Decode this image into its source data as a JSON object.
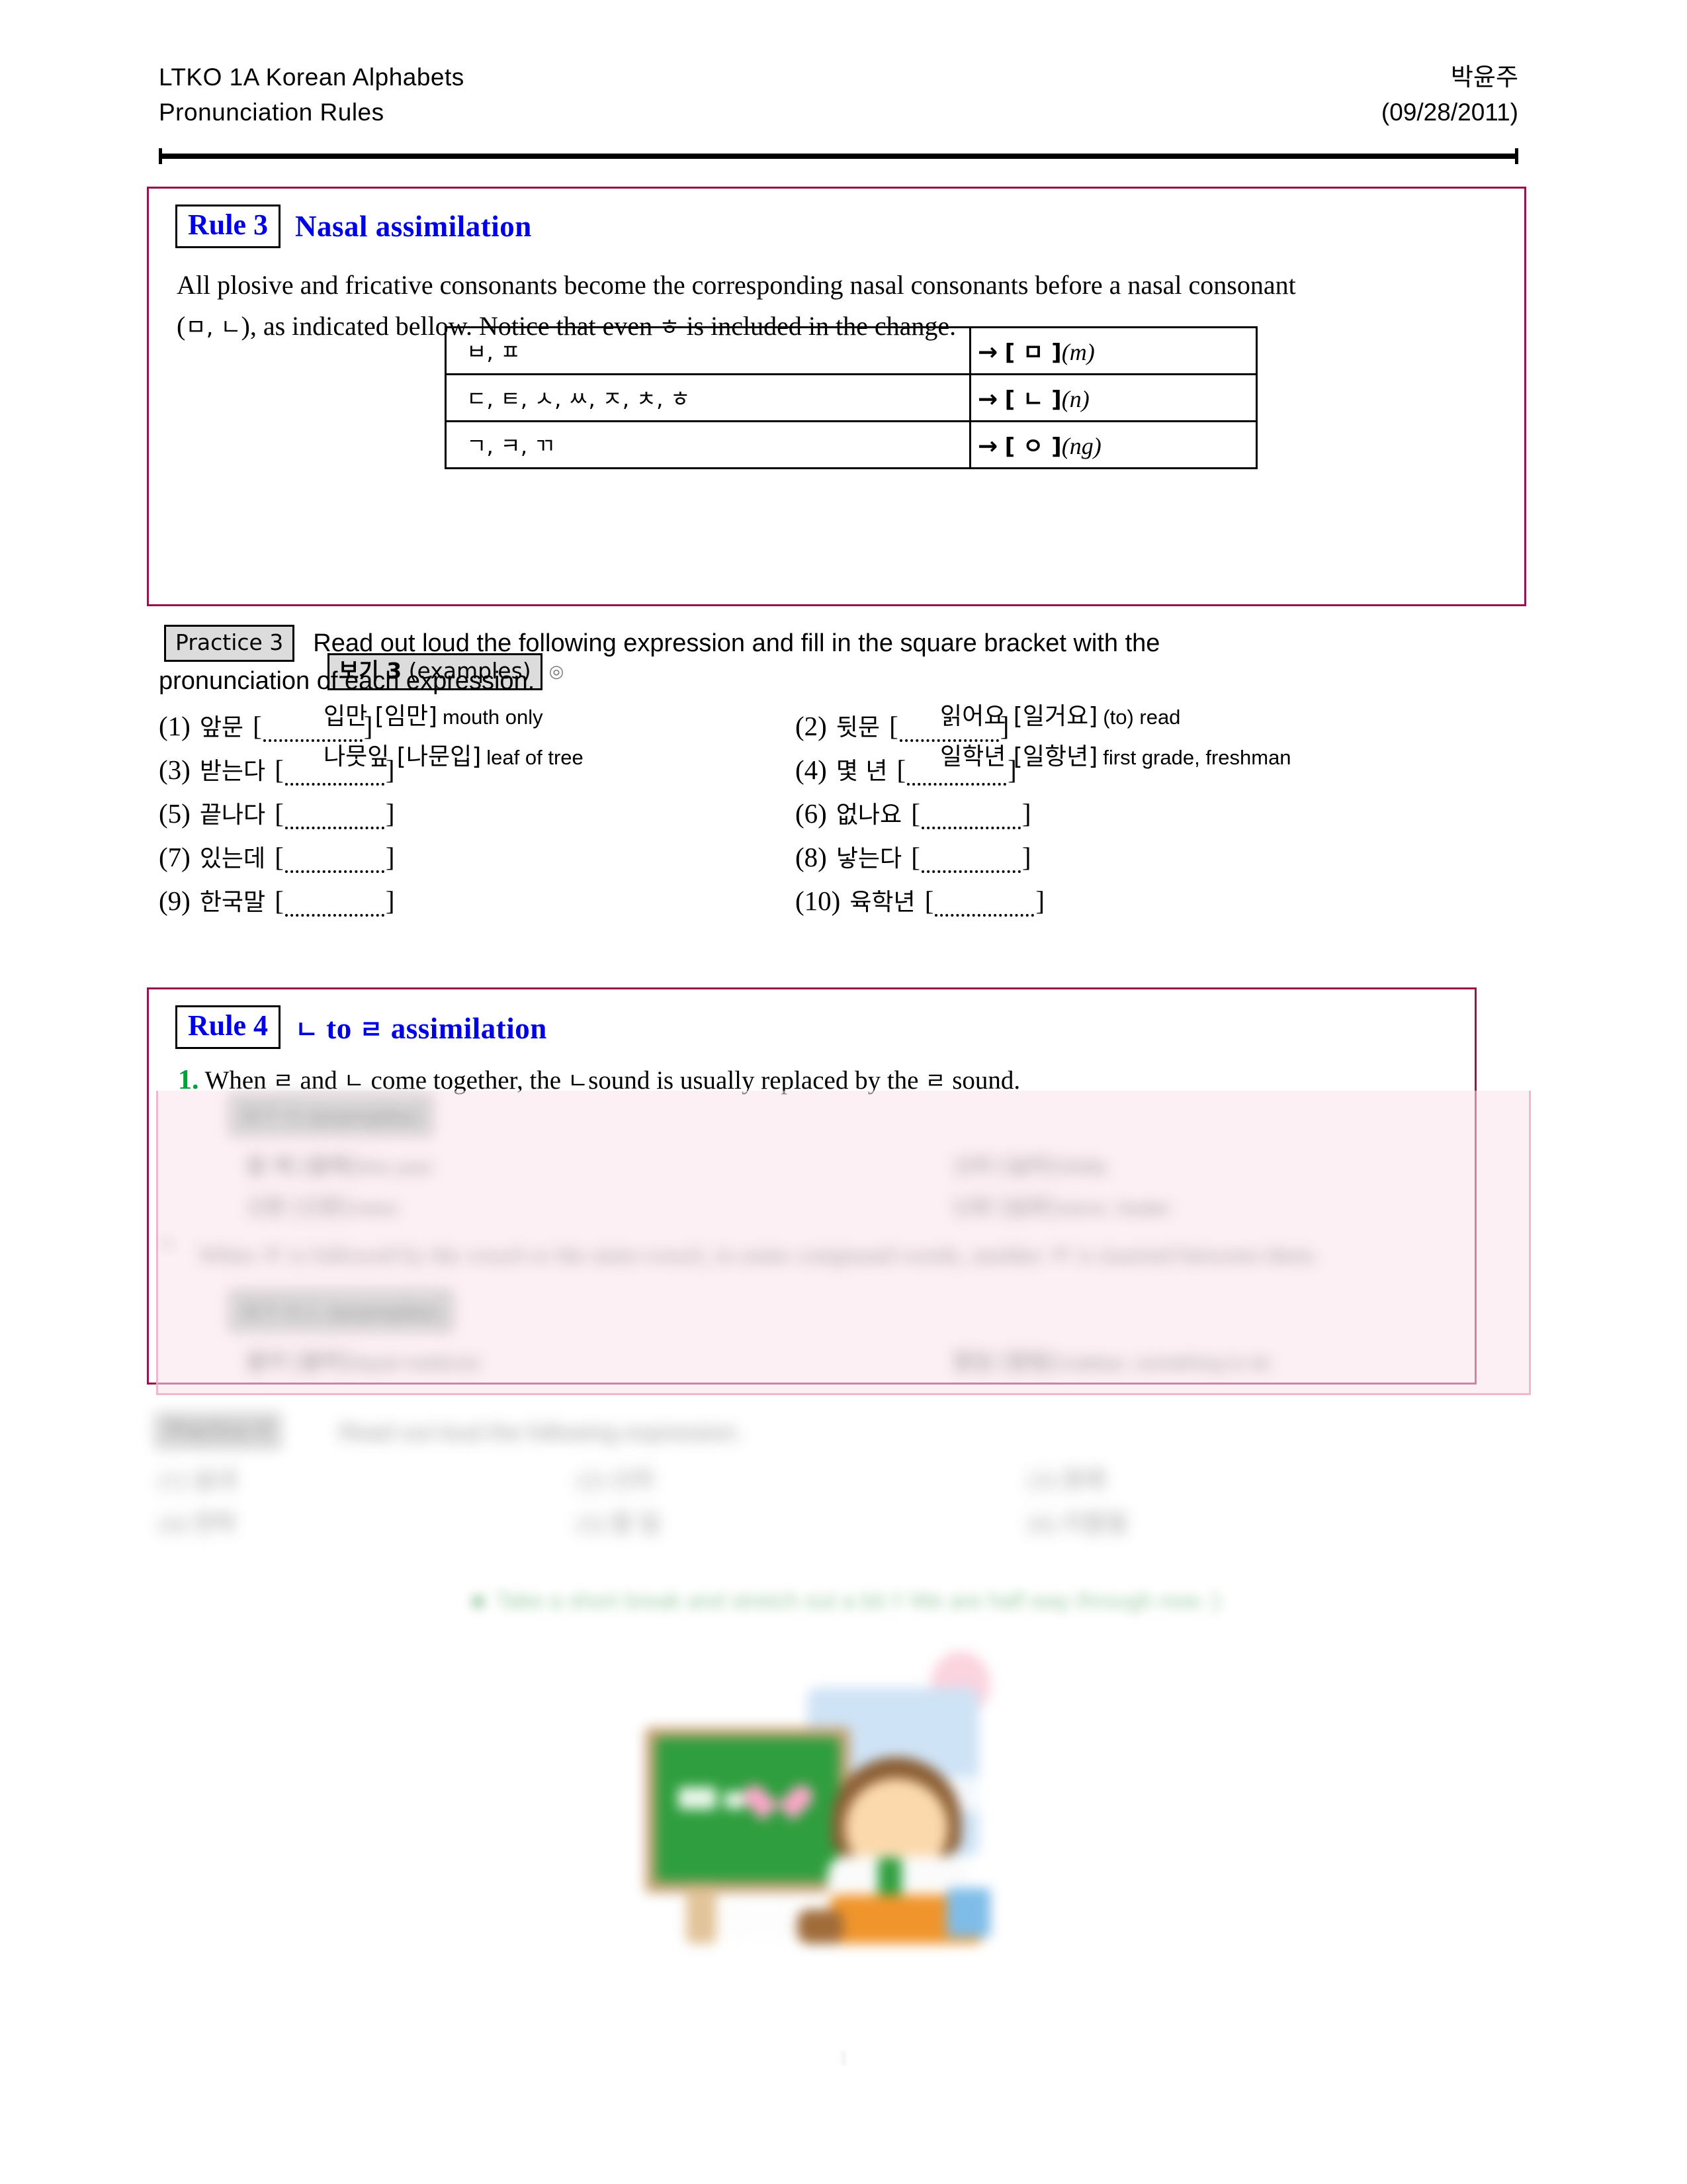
{
  "header": {
    "course_line1": "LTKO  1A  Korean Alphabets",
    "course_line2": "Pronunciation Rules",
    "author": "박윤주",
    "date": "(09/28/2011)"
  },
  "rule3": {
    "tag": "Rule 3",
    "title": "Nasal assimilation",
    "body_part1": "All plosive and fricative consonants become the corresponding nasal consonants before a nasal consonant",
    "body_paren_open": "(",
    "body_nasals": "ㅁ, ㄴ",
    "body_paren_close": ")",
    "body_part2": ", as indicated bellow. Notice that even",
    "body_hieut": "ㅎ",
    "body_part3": "is included in the change.",
    "table": [
      {
        "sources": "ㅂ, ㅍ",
        "arrow": "→",
        "result": "[ ㅁ ]",
        "roman": "(m)"
      },
      {
        "sources": "ㄷ, ㅌ, ㅅ, ㅆ, ㅈ, ㅊ, ㅎ",
        "arrow": "→",
        "result": "[ ㄴ ]",
        "roman": "(n)"
      },
      {
        "sources": "ㄱ, ㅋ, ㄲ",
        "arrow": "→",
        "result": "[ ㅇ ]",
        "roman": "(ng)"
      }
    ],
    "examples_tag_bold": "보기 3",
    "examples_tag_rest": "(examples)",
    "examples_marker": "◎",
    "examples": [
      {
        "kr": "입만 [임만]",
        "en": "mouth only"
      },
      {
        "kr": "읽어요 [일거요]",
        "en": "(to) read"
      },
      {
        "kr": "나뭇잎 [나문입]",
        "en": "leaf of tree"
      },
      {
        "kr": "일학년 [일항년]",
        "en": "first grade, freshman"
      }
    ]
  },
  "practice3": {
    "tag": "Practice 3",
    "instruction_line1": "Read out loud the following expression and fill in the square bracket with the",
    "instruction_line2": "pronunciation of each expression.",
    "items": [
      {
        "num": "(1)",
        "word": "앞문"
      },
      {
        "num": "(2)",
        "word": "뒷문"
      },
      {
        "num": "(3)",
        "word": "받는다"
      },
      {
        "num": "(4)",
        "word": "몇 년"
      },
      {
        "num": "(5)",
        "word": "끝나다"
      },
      {
        "num": "(6)",
        "word": "없나요"
      },
      {
        "num": "(7)",
        "word": "있는데"
      },
      {
        "num": "(8)",
        "word": "낳는다"
      },
      {
        "num": "(9)",
        "word": "한국말"
      },
      {
        "num": "(10)",
        "word": "육학년"
      }
    ],
    "bracket_open": "[",
    "bracket_close": "]"
  },
  "rule4": {
    "tag": "Rule 4",
    "title_part1": "ㄴ",
    "title_to": "to",
    "title_part2": "ㄹ",
    "title_part3": "assimilation",
    "item1_num": "1.",
    "item1_a": "When",
    "item1_rieul": "ㄹ",
    "item1_b": "and",
    "item1_nieun": "ㄴ",
    "item1_c": "come together, the",
    "item1_nieun2": "ㄴ",
    "item1_d": "sound is usually replaced by the",
    "item1_rieul2": "ㄹ",
    "item1_e": "sound.",
    "examples_tag": "보기 4 (examples)",
    "examples_a": [
      {
        "kr": "올 해 [올해]",
        "en": "this year"
      },
      {
        "kr": "신라 [실라]",
        "en": "Shilla"
      },
      {
        "kr": "신문 [신문]",
        "en": "news"
      },
      {
        "kr": "난로 [날로]",
        "en": "stove, heater"
      }
    ],
    "item2_num": "2.",
    "item2_text": "When  ㄹ  is followed by the vowel  or the stem-vowel, in some compound words, another  ㄹ  is inserted between them.",
    "examples_tag2": "보기 4-1 (examples)",
    "examples_b": [
      {
        "kr": "물약 [물략]",
        "en": "liquid medicine"
      },
      {
        "kr": "할일 [할릴]",
        "en": "mattear, something to do"
      }
    ]
  },
  "practice4": {
    "tag": "Practice 4",
    "instruction": "Read out loud the following expression.",
    "items": [
      {
        "num": "(1)",
        "word": "실내"
      },
      {
        "num": "(2)",
        "word": "신라"
      },
      {
        "num": "(3)",
        "word": "원래"
      },
      {
        "num": "(4)",
        "word": "연락"
      },
      {
        "num": "(5)",
        "word": "할 일"
      },
      {
        "num": "(6)",
        "word": "지할철"
      }
    ]
  },
  "break_note": "☻ Take a short break and stretch out a bit !! We are half way through now :)",
  "clipart": {
    "name": "student-at-chalkboard-clipart",
    "board_color": "#2f9e3e",
    "heart_color": "#f9a8c8",
    "sky_color": "#cfe3f6"
  },
  "page_number": "1"
}
